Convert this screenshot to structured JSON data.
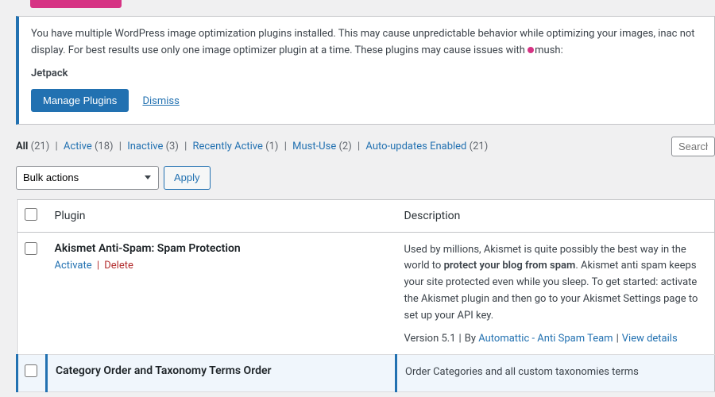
{
  "notice": {
    "message_a": "You have multiple WordPress image optimization plugins installed. This may cause unpredictable behavior while optimizing your images, inac",
    "message_b": "not display. For best results use only one image optimizer plugin at a time. These plugins may cause issues with ",
    "smush_word": "mush:",
    "brand": "Jetpack",
    "manage_btn": "Manage Plugins",
    "dismiss": "Dismiss"
  },
  "filters": {
    "all_label": "All",
    "all_count": "(21)",
    "active_label": "Active",
    "active_count": "(18)",
    "inactive_label": "Inactive",
    "inactive_count": "(3)",
    "recent_label": "Recently Active",
    "recent_count": "(1)",
    "mustuse_label": "Must-Use",
    "mustuse_count": "(2)",
    "auto_label": "Auto-updates Enabled",
    "auto_count": "(21)"
  },
  "search": {
    "placeholder": "Search"
  },
  "bulk": {
    "selected": "Bulk actions",
    "apply": "Apply"
  },
  "table": {
    "col_plugin": "Plugin",
    "col_desc": "Description"
  },
  "rows": [
    {
      "title": "Akismet Anti-Spam: Spam Protection",
      "action_activate": "Activate",
      "action_delete": "Delete",
      "desc_pre": "Used by millions, Akismet is quite possibly the best way in the world to ",
      "desc_strong": "protect your blog from spam",
      "desc_post": ". Akismet anti spam keeps your site protected even while you sleep. To get started: activate the Akismet plugin and then go to your Akismet Settings page to set up your API key.",
      "version": "Version 5.1",
      "by": "By ",
      "author": "Automattic - Anti Spam Team",
      "view": "View details"
    },
    {
      "title": "Category Order and Taxonomy Terms Order",
      "desc": "Order Categories and all custom taxonomies terms"
    }
  ]
}
